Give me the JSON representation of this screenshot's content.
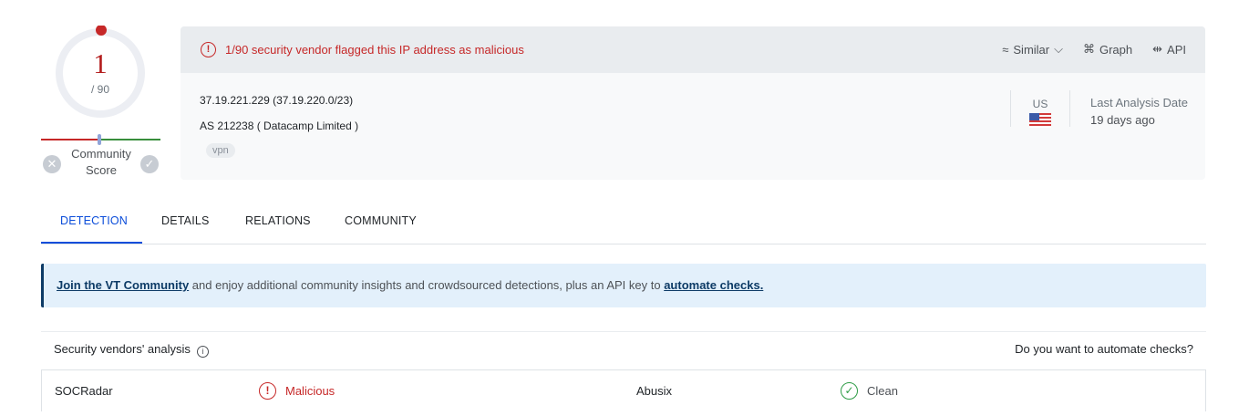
{
  "score": {
    "detections": "1",
    "total": "/ 90"
  },
  "community": {
    "label": "Community Score",
    "down_icon": "x-icon",
    "up_icon": "check-icon"
  },
  "summary": {
    "alert_text": "1/90 security vendor flagged this IP address as malicious",
    "actions": [
      {
        "label": "Similar",
        "icon": "similar-icon"
      },
      {
        "label": "Graph",
        "icon": "graph-icon"
      },
      {
        "label": "API",
        "icon": "api-icon"
      }
    ],
    "ip": "37.19.221.229  (37.19.220.0/23)",
    "asn": "AS 212238  ( Datacamp Limited )",
    "tag": "vpn",
    "country": "US",
    "last_analysis_label": "Last Analysis Date",
    "last_analysis_value": "19 days ago"
  },
  "tabs": [
    "DETECTION",
    "DETAILS",
    "RELATIONS",
    "COMMUNITY"
  ],
  "active_tab": "DETECTION",
  "banner": {
    "link1": "Join the VT Community",
    "middle": " and enjoy additional community insights and crowdsourced detections, plus an API key to ",
    "link2": "automate checks."
  },
  "vendors": {
    "title": "Security vendors' analysis",
    "automate_prompt": "Do you want to automate checks?",
    "rows": [
      {
        "vendor1": "SOCRadar",
        "result1": "Malicious",
        "vendor2": "Abusix",
        "result2": "Clean"
      }
    ]
  },
  "colors": {
    "malicious": "#c62828",
    "clean": "#2e9c46",
    "accent": "#0b4dda"
  }
}
